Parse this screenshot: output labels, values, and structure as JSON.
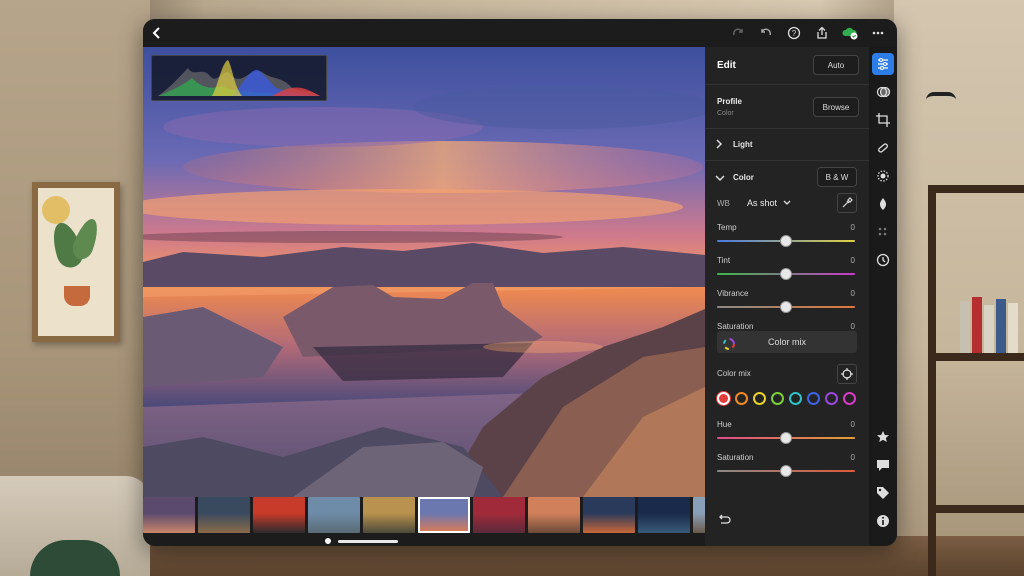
{
  "app": {
    "colors": {
      "accent": "#2c7de8",
      "panel_bg": "#232323",
      "window_bg": "#1c1c1c"
    }
  },
  "topbar": {
    "icons": [
      "back-icon",
      "redo-icon",
      "undo-icon",
      "help-icon",
      "share-icon",
      "cloud-synced-icon",
      "more-icon"
    ]
  },
  "edit": {
    "title": "Edit",
    "auto_label": "Auto",
    "profile": {
      "title": "Profile",
      "value": "Color",
      "browse_label": "Browse"
    },
    "light": {
      "title": "Light",
      "expanded": false
    },
    "color": {
      "title": "Color",
      "expanded": true,
      "bw_label": "B & W",
      "wb_label": "WB",
      "wb_value": "As shot",
      "sliders": [
        {
          "label": "Temp",
          "value": "0",
          "level": 0.5
        },
        {
          "label": "Tint",
          "value": "0",
          "level": 0.5
        },
        {
          "label": "Vibrance",
          "value": "0",
          "level": 0.5
        },
        {
          "label": "Saturation",
          "value": "0",
          "level": 0.5
        }
      ],
      "color_mix_button": "Color mix",
      "color_mix_label": "Color mix",
      "swatches": [
        "#e43b3b",
        "#f08a24",
        "#e8d12a",
        "#7bcf3b",
        "#2fc3c9",
        "#3e63e6",
        "#9a46e0",
        "#d83ac8"
      ],
      "selected_swatch": 0,
      "mix_sliders": [
        {
          "label": "Hue",
          "value": "0",
          "level": 0.5
        },
        {
          "label": "Saturation",
          "value": "0",
          "level": 0.5
        }
      ]
    }
  },
  "toolbar": {
    "tools": [
      "edit-sliders-icon",
      "presets-icon",
      "crop-icon",
      "healing-brush-icon",
      "masking-icon",
      "optics-icon",
      "effects-icon",
      "versions-icon",
      "rate-icon",
      "comment-icon",
      "tag-icon",
      "info-icon"
    ],
    "active": 0
  },
  "filmstrip": {
    "selected": 5,
    "thumb_colors": [
      [
        "#5b4a6e",
        "#c9866a"
      ],
      [
        "#3a4a5e",
        "#8a6b4a"
      ],
      [
        "#c83a2a",
        "#2b2b2b"
      ],
      [
        "#6e8ca8",
        "#5a6a74"
      ],
      [
        "#b8924e",
        "#4c4a3a"
      ],
      [
        "#6b78b0",
        "#e07a52"
      ],
      [
        "#a02a3a",
        "#5a2a3a"
      ],
      [
        "#d0805a",
        "#6a4a3a"
      ],
      [
        "#2a3a5a",
        "#c8683a"
      ],
      [
        "#1a2a4a",
        "#3a5a7a"
      ],
      [
        "#8aa0b8",
        "#6a5a4a"
      ],
      [
        "#3a3a3a",
        "#c8c8c8"
      ]
    ]
  }
}
